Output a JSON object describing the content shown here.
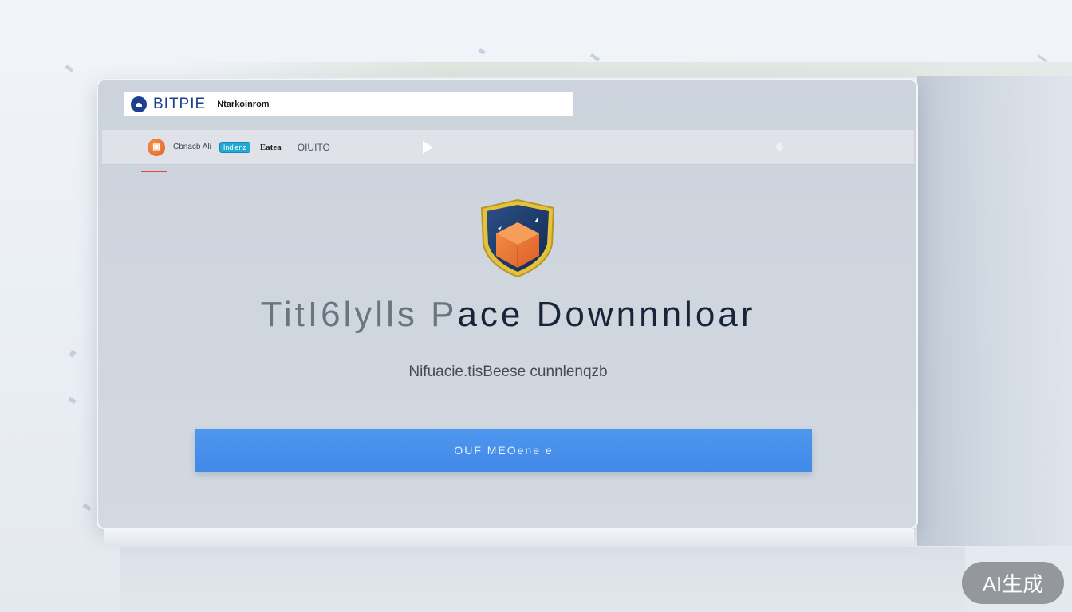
{
  "address_bar": {
    "brand": "BITPIE",
    "url": "Ntarkoinrom"
  },
  "toolbar": {
    "tab_label": "Cbnacb Ali",
    "badge": "Indienz",
    "menu_bold": "Eatea",
    "menu_light": "OIUITO"
  },
  "content": {
    "title_faded": "TitI6lylls P",
    "title_rest": "ace Downnnloar",
    "subtitle": "Nifuacie.tisBeese cunnlenqzb",
    "download_button": "OUF MEOene e"
  },
  "watermark": "AI生成",
  "colors": {
    "accent_blue": "#4a90ea",
    "brand_blue": "#1d3f8f",
    "badge_teal": "#23a9d6",
    "shield_orange": "#ee7a35",
    "shield_gold": "#e4c23a"
  }
}
